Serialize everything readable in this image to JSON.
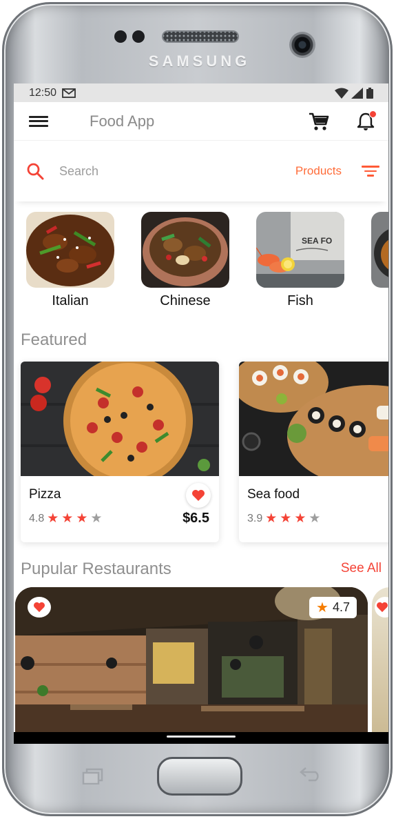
{
  "device": {
    "brand": "SAMSUNG"
  },
  "status_bar": {
    "time": "12:50",
    "notification_icon": "gmail-icon",
    "icons": [
      "wifi-icon",
      "signal-icon",
      "battery-icon"
    ]
  },
  "app_bar": {
    "title": "Food App",
    "menu_icon": "menu-icon",
    "cart_icon": "cart-icon",
    "notification_icon": "bell-icon"
  },
  "search": {
    "placeholder": "Search",
    "scope_label": "Products",
    "filter_icon": "filter-icon"
  },
  "categories": [
    {
      "label": "Italian"
    },
    {
      "label": "Chinese"
    },
    {
      "label": "Fish"
    },
    {
      "label": ""
    }
  ],
  "featured": {
    "title": "Featured",
    "items": [
      {
        "name": "Pizza",
        "rating": "4.8",
        "stars": 3,
        "max_stars": 4,
        "price": "$6.5",
        "favorite": true
      },
      {
        "name": "Sea food",
        "rating": "3.9",
        "stars": 3,
        "max_stars": 4
      }
    ]
  },
  "restaurants": {
    "title": "Pupular Restaurants",
    "see_all": "See All",
    "items": [
      {
        "rating": "4.7",
        "favorite": true
      }
    ]
  },
  "colors": {
    "accent": "#f44336",
    "orange": "#ff6d3a",
    "muted_text": "#8f8f8f"
  }
}
